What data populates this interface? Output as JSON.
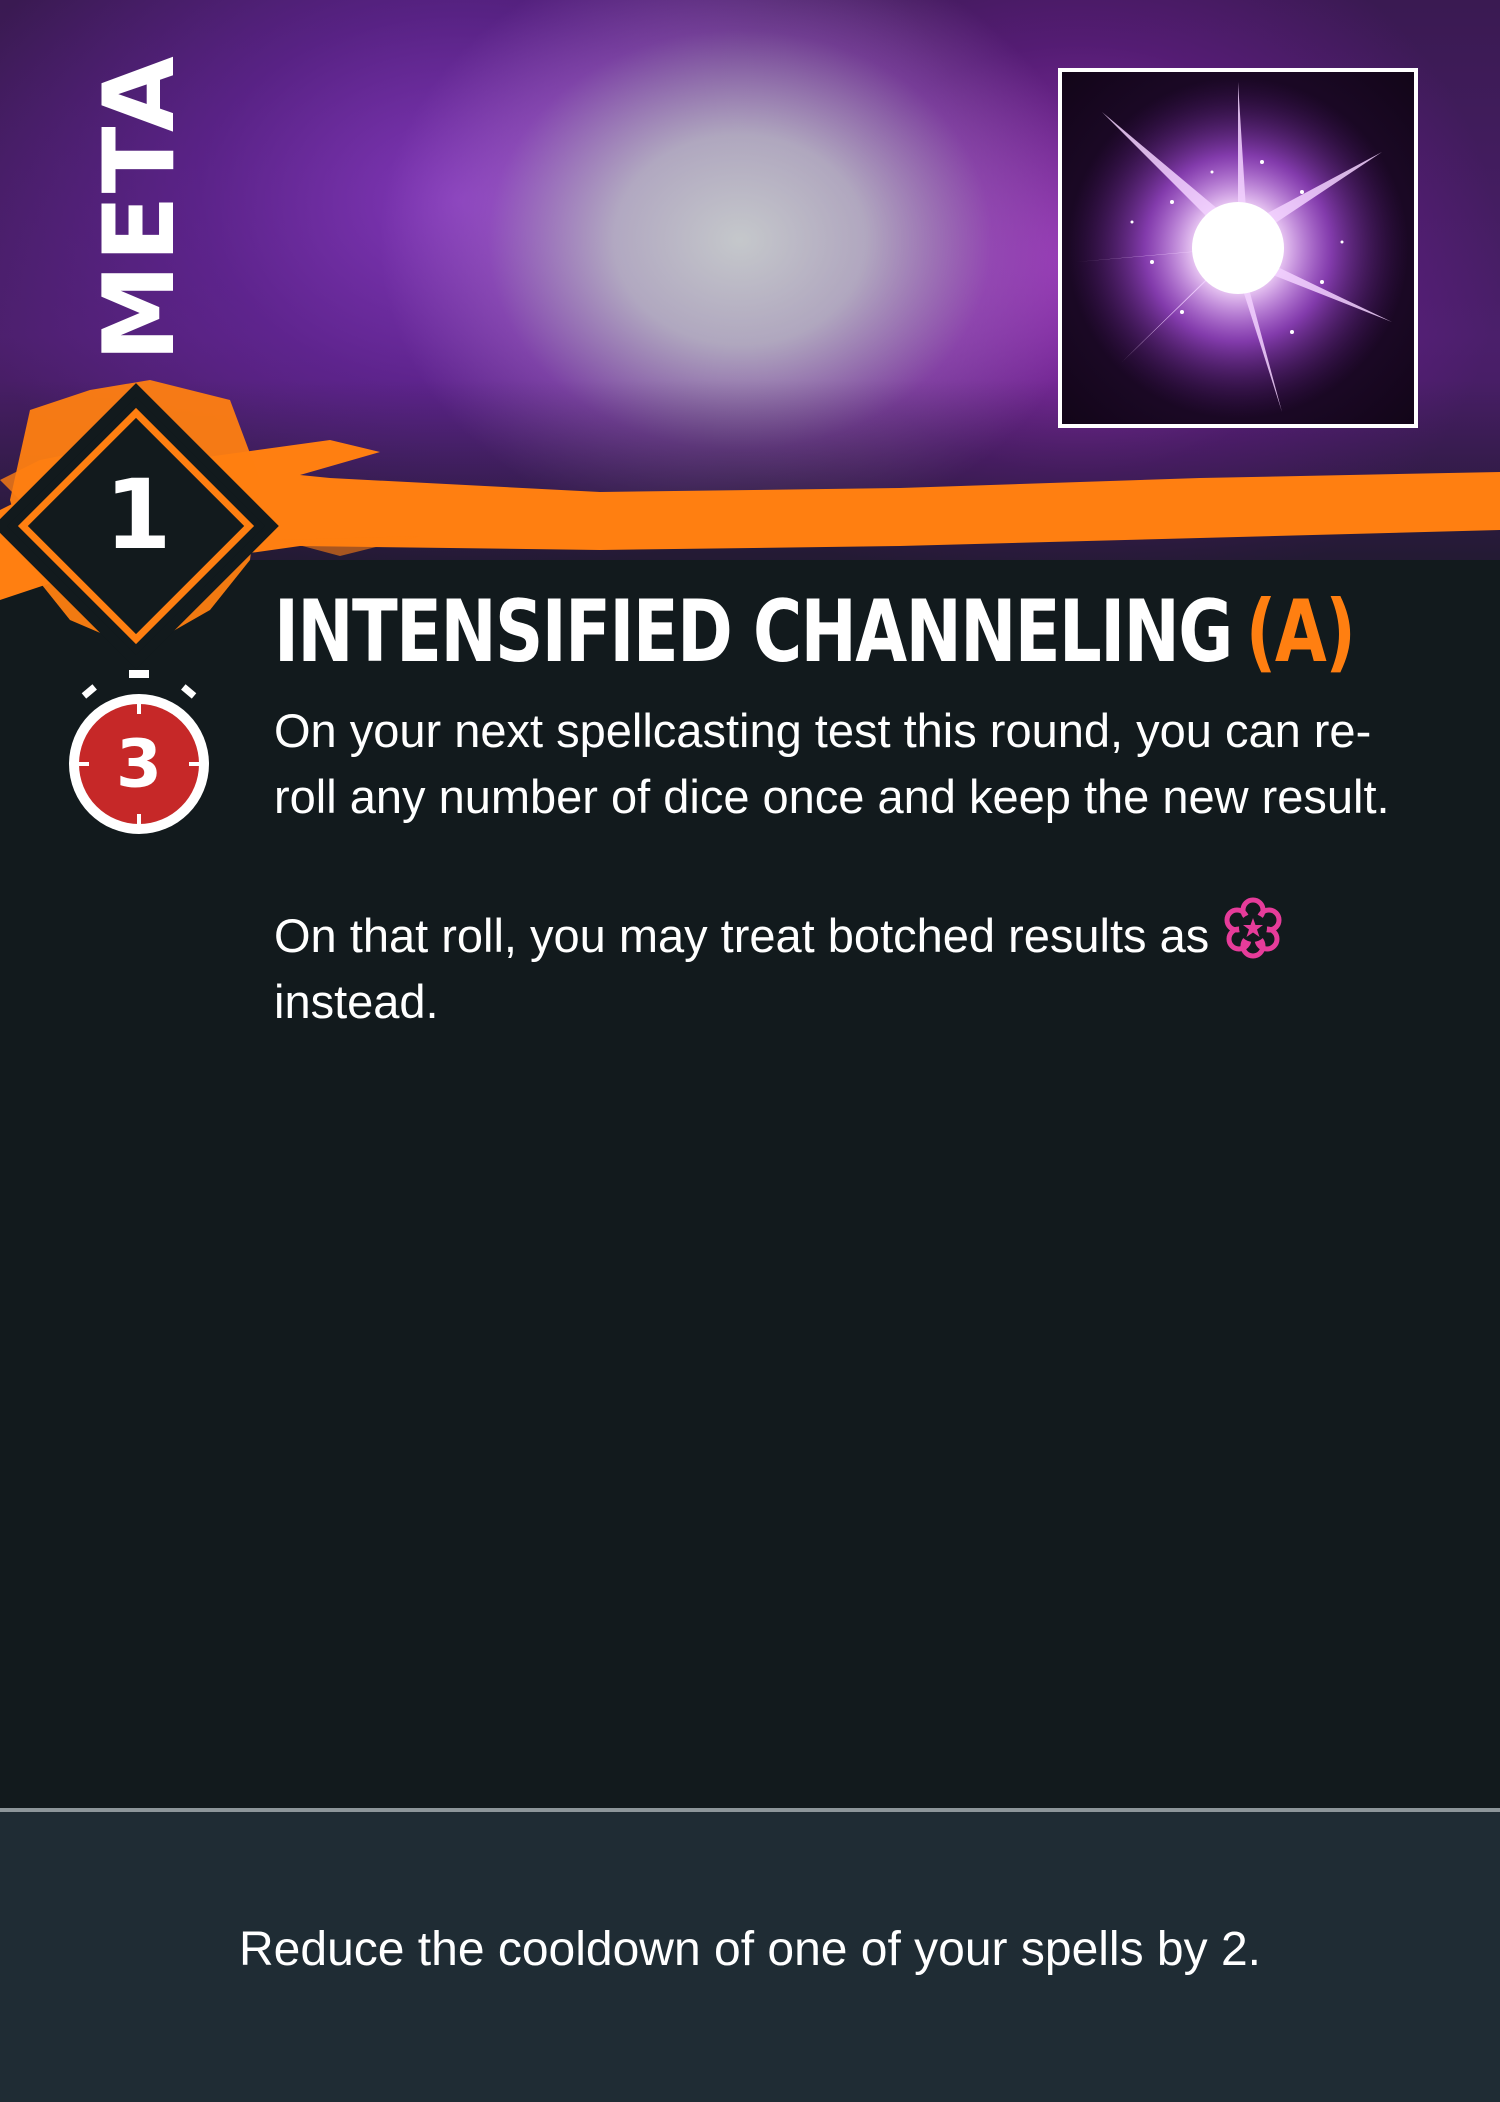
{
  "card": {
    "category": "META",
    "level": "1",
    "cooldown": "3",
    "title": "INTENSIFIED CHANNELING",
    "tag": "(A)",
    "body": {
      "paragraph1": "On your next spellcasting test this round, you can re-roll any number of dice once and keep the new result.",
      "paragraph2_before_icon": "On that roll, you may treat botched results as",
      "paragraph2_after_icon": "instead.",
      "inline_icon": "success-symbol-icon"
    },
    "footer": "Reduce the cooldown of one of your spells by 2."
  },
  "colors": {
    "accent": "#ff7f11",
    "background": "#121a1d",
    "footer": "#1f2c34",
    "timer_red": "#c62828",
    "success_pink": "#e63c9a"
  }
}
